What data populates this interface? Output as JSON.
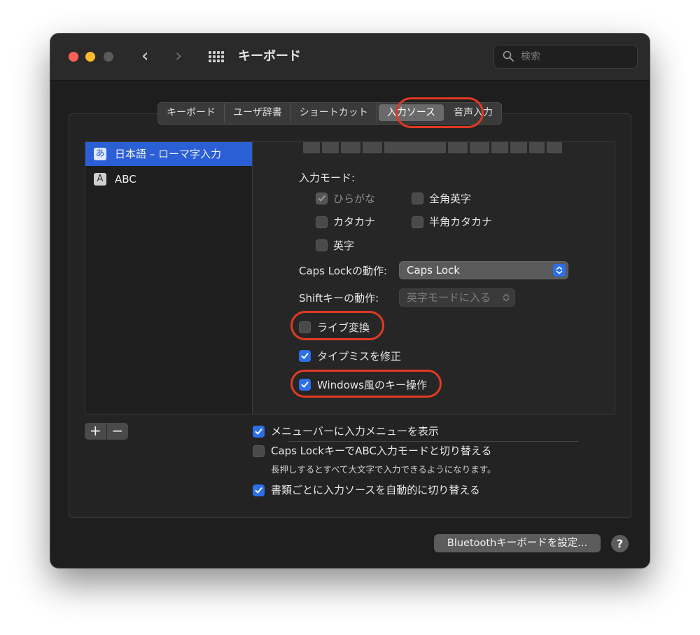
{
  "window": {
    "title": "キーボード",
    "search_placeholder": "検索"
  },
  "tabs": [
    {
      "label": "キーボード",
      "active": false
    },
    {
      "label": "ユーザ辞書",
      "active": false
    },
    {
      "label": "ショートカット",
      "active": false
    },
    {
      "label": "入力ソース",
      "active": true
    },
    {
      "label": "音声入力",
      "active": false
    }
  ],
  "sources": [
    {
      "label": "日本語 – ローマ字入力",
      "icon_char": "あ",
      "icon": "hiragana-icon",
      "selected": true
    },
    {
      "label": "ABC",
      "icon_char": "A",
      "icon": "abc-icon",
      "selected": false
    }
  ],
  "settings": {
    "input_mode_label": "入力モード:",
    "modes": {
      "hiragana": {
        "label": "ひらがな",
        "checked": true,
        "disabled": true
      },
      "zenkaku_eiji": {
        "label": "全角英字",
        "checked": false
      },
      "katakana": {
        "label": "カタカナ",
        "checked": false
      },
      "hankaku_katakana": {
        "label": "半角カタカナ",
        "checked": false
      },
      "eiji": {
        "label": "英字",
        "checked": false
      }
    },
    "caps_lock_label": "Caps Lockの動作:",
    "caps_lock_value": "Caps Lock",
    "shift_label": "Shiftキーの動作:",
    "shift_value": "英字モードに入る",
    "live_conversion": {
      "label": "ライブ変換",
      "checked": false
    },
    "typo_fix": {
      "label": "タイプミスを修正",
      "checked": true
    },
    "windows_keys": {
      "label": "Windows風のキー操作",
      "checked": true
    }
  },
  "list_controls": {
    "add": "+",
    "remove": "−"
  },
  "bottom": {
    "show_menu": {
      "label": "メニューバーに入力メニューを表示",
      "checked": true
    },
    "caps_switch": {
      "label": "Caps LockキーでABC入力モードと切り替える",
      "checked": false
    },
    "caps_note": "長押しするとすべて大文字で入力できるようになります。",
    "auto_switch": {
      "label": "書類ごとに入力ソースを自動的に切り替える",
      "checked": true
    }
  },
  "footer": {
    "bluetooth_button": "Bluetoothキーボードを設定...",
    "help": "?"
  },
  "colors": {
    "accent": "#2c6fe8",
    "selection": "#2a5fd6",
    "highlight_ring": "#e03a22"
  }
}
